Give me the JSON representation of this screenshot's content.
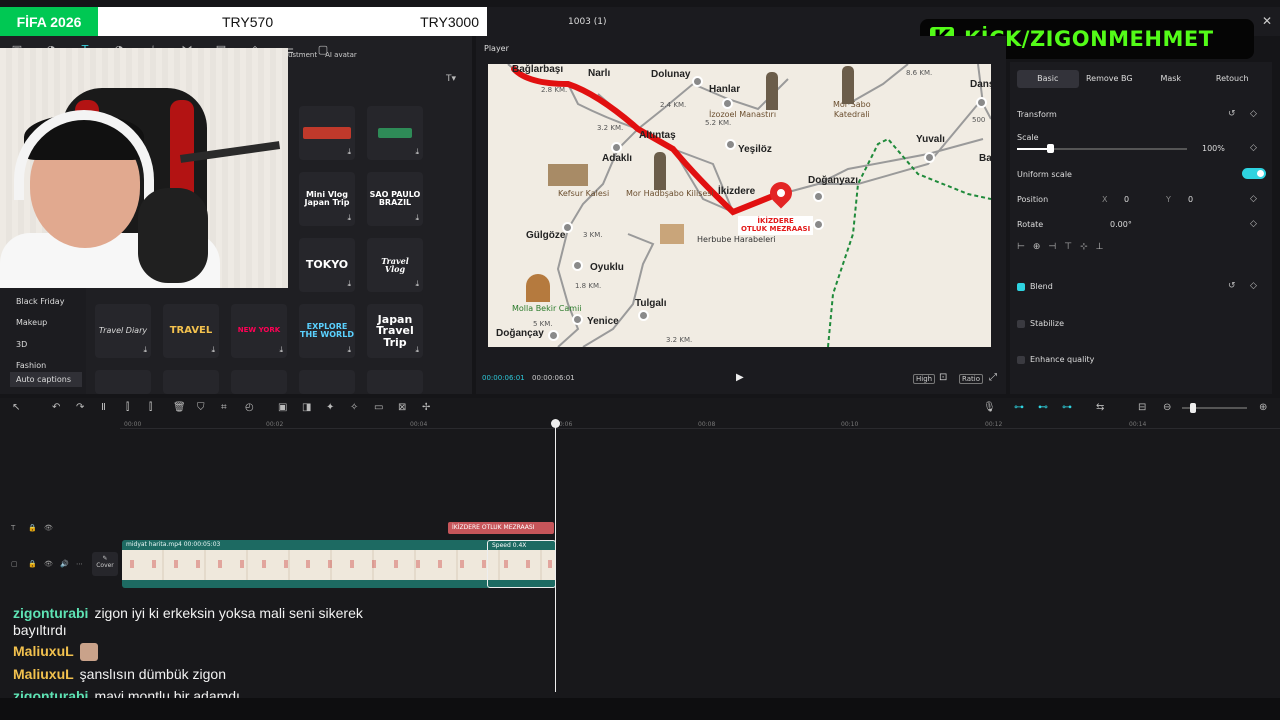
{
  "banner": {
    "badge": "FİFA 2026",
    "price1": "TRY570",
    "price2": "TRY3000"
  },
  "window": {
    "title": "1003 (1)"
  },
  "overlay": {
    "kick_logo": "K",
    "kick_text": "KİCK/ZIGONMEHMET"
  },
  "toolbar": {
    "labels": [
      "justment",
      "AI avatar"
    ]
  },
  "sidebar": {
    "categories": [
      "Black Friday",
      "Makeup",
      "3D",
      "Fashion",
      "Auto captions"
    ]
  },
  "tiles": [
    "",
    "",
    "Mini Vlog\nJapan Trip",
    "SAO PAULO\nBRAZIL",
    "TOKYO",
    "Travel\nVlog",
    "Travel Diary",
    "TRAVEL",
    "NEW YORK",
    "EXPLORE\nTHE WORLD",
    "Japan\nTravel Trip"
  ],
  "player": {
    "label": "Player",
    "time_current": "00:00:06:01",
    "time_total": "00:00:06:01",
    "controls": [
      "High",
      "Ratio"
    ]
  },
  "map": {
    "places": {
      "baglarbasi": "Bağlarbaşı",
      "narli": "Narlı",
      "dolunay": "Dolunay",
      "hanlar": "Hanlar",
      "altintas": "Altıntaş",
      "adakli": "Adaklı",
      "yesiloz": "Yeşilöz",
      "ikizdere": "İkizdere",
      "doganyazi": "Doğanyazı",
      "yuvali": "Yuvalı",
      "gulgoze": "Gülgöze",
      "oyuklu": "Oyuklu",
      "tulgali": "Tulgalı",
      "yenice": "Yenice",
      "dogancay": "Doğançay",
      "dans": "Danş",
      "ba": "Ba"
    },
    "landmarks": {
      "izozoel": "İzozoel Manastırı",
      "morsabo": "Mor Sabo\nKatedrali",
      "kefsur": "Kefsur Kalesi",
      "morhad": "Mor Hadbşabo Kilisesi",
      "herbube": "Herbube Harabeleri",
      "mollabekir": "Molla Bekir Camii"
    },
    "distances": [
      "2.8 KM.",
      "2.4 KM.",
      "5.2 KM.",
      "3.2 KM.",
      "3 KM.",
      "1.8 KM.",
      "5 KM.",
      "3.2 KM.",
      "8.6 KM.",
      "500"
    ],
    "destination": "İKİZDERE\nOTLUK MEZRAASI",
    "route_color": "#e11010"
  },
  "inspector": {
    "tabs": [
      "Basic",
      "Remove BG",
      "Mask",
      "Retouch"
    ],
    "transform": "Transform",
    "scale": "Scale",
    "scale_value": "100%",
    "scale_level": 0.19,
    "uniform_scale": "Uniform scale",
    "position": "Position",
    "pos_x_label": "X",
    "pos_x": "0",
    "pos_y_label": "Y",
    "pos_y": "0",
    "rotate": "Rotate",
    "rotate_value": "0.00°",
    "blend": "Blend",
    "stabilize": "Stabilize",
    "enhance": "Enhance quality"
  },
  "timeline": {
    "ticks": [
      "00:00",
      "00:02",
      "00:04",
      "00:06",
      "00:08",
      "00:10",
      "00:12",
      "00:14"
    ],
    "text_clip": "İKİZDERE  OTLUK MEZRAASI",
    "video_clip": "midyat harita.mp4   00:00:05:03",
    "speed_clip": "Speed 0.4X",
    "cover": "Cover"
  },
  "chat": [
    {
      "user": "zigonturabi",
      "color": "#5ee3b4",
      "text": "zigon iyi ki erkeksin yoksa mali seni sikerek"
    },
    {
      "user": "",
      "color": "#f2f2f2",
      "text": "bayıltırdı"
    },
    {
      "user": "MaliuxuL",
      "color": "#f2c14e",
      "text": ""
    },
    {
      "user": "MaliuxuL",
      "color": "#f2c14e",
      "text": "şanslısın dümbük zigon"
    },
    {
      "user": "zigonturabi",
      "color": "#5ee3b4",
      "text": "mavi montlu bir adamdı"
    }
  ]
}
